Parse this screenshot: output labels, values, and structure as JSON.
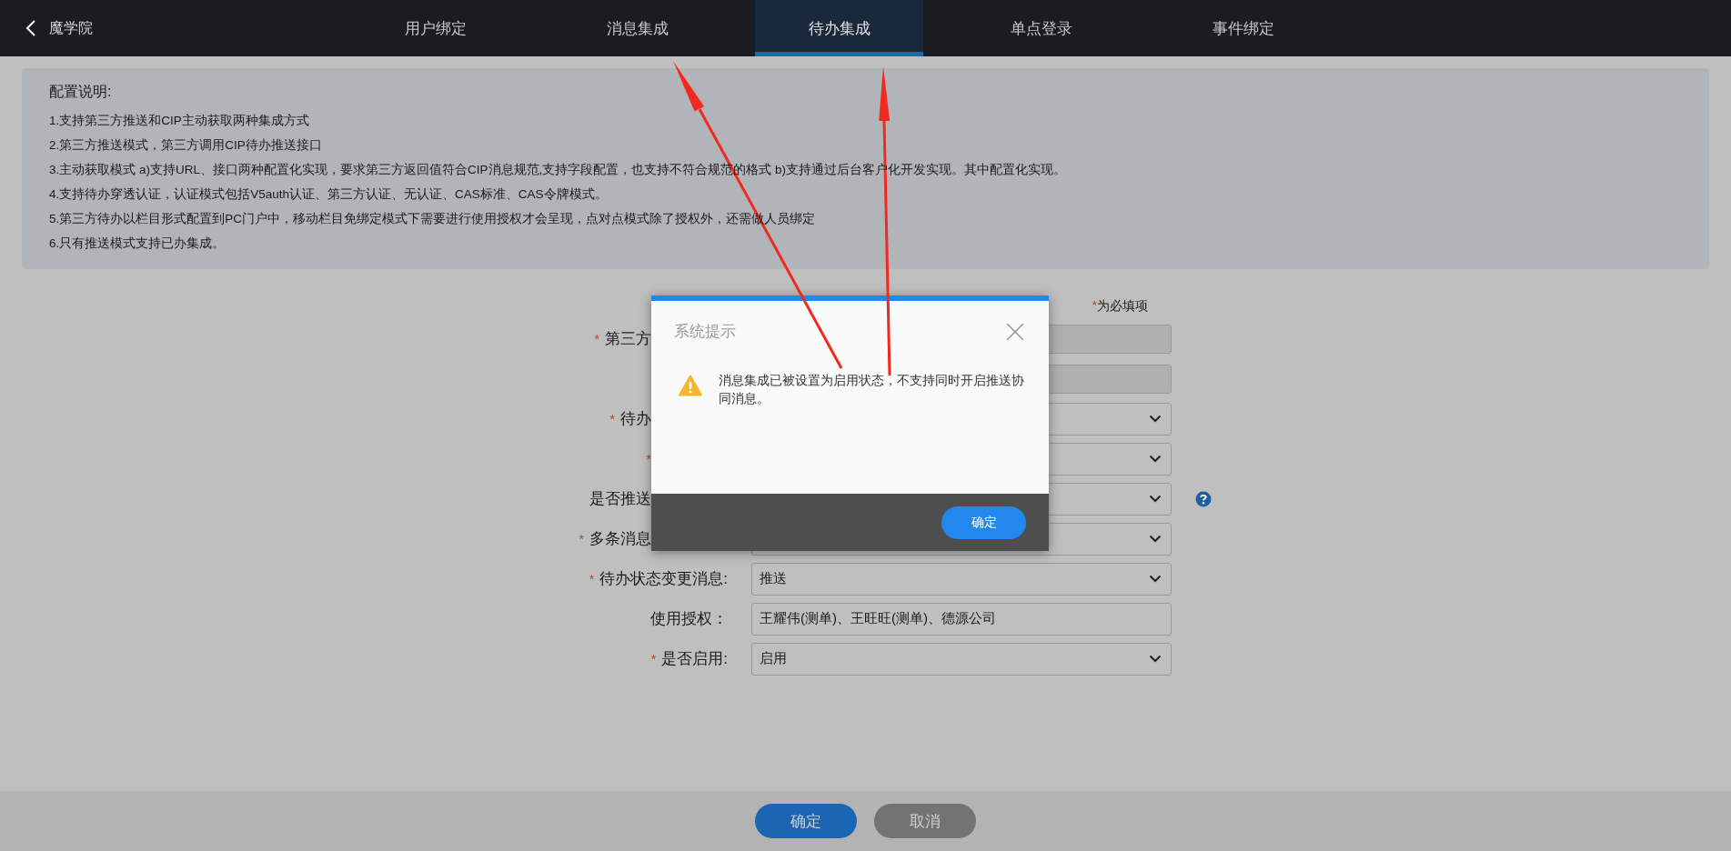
{
  "header": {
    "title": "魔学院",
    "tabs": [
      {
        "label": "用户绑定",
        "selected": false
      },
      {
        "label": "消息集成",
        "selected": false
      },
      {
        "label": "待办集成",
        "selected": true
      },
      {
        "label": "单点登录",
        "selected": false
      },
      {
        "label": "事件绑定",
        "selected": false
      }
    ]
  },
  "info": {
    "title": "配置说明:",
    "lines": [
      "1.支持第三方推送和CIP主动获取两种集成方式",
      "2.第三方推送模式，第三方调用CIP待办推送接口",
      "3.主动获取模式 a)支持URL、接口两种配置化实现，要求第三方返回值符合CIP消息规范,支持字段配置，也支持不符合规范的格式 b)支持通过后台客户化开发实现。其中配置化实现。",
      "4.支持待办穿透认证，认证模式包括V5auth认证、第三方认证、无认证、CAS标准、CAS令牌模式。",
      "5.第三方待办以栏目形式配置到PC门户中，移动栏目免绑定模式下需要进行使用授权才会呈现，点对点模式除了授权外，还需做人员绑定",
      "6.只有推送模式支持已办集成。"
    ]
  },
  "required_note": {
    "mark": "*",
    "text": "为必填项"
  },
  "form": {
    "fields": [
      {
        "label": "第三方",
        "required": true,
        "covered": true,
        "kind": "text",
        "disabled": true
      },
      {
        "required": false,
        "covered": true,
        "kind": "text",
        "disabled": true
      },
      {
        "label": "待办",
        "required": true,
        "covered": true,
        "kind": "select",
        "disabled": false
      },
      {
        "required": true,
        "covered": true,
        "kind": "select",
        "disabled": false
      },
      {
        "label": "是否推送",
        "required": false,
        "covered": true,
        "kind": "select",
        "disabled": false,
        "help": true
      },
      {
        "label": "多条消息",
        "required": true,
        "covered": true,
        "kind": "select",
        "disabled": false
      },
      {
        "label": "待办状态变更消息:",
        "required": true,
        "kind": "select",
        "disabled": false,
        "value": "推送"
      },
      {
        "label": "使用授权：",
        "required": false,
        "kind": "text",
        "disabled": false,
        "value": "王耀伟(测单)、王旺旺(测单)、德源公司"
      },
      {
        "label": "是否启用:",
        "required": true,
        "kind": "select",
        "disabled": false,
        "value": "启用"
      }
    ]
  },
  "footer": {
    "buttons": [
      {
        "label": "确定",
        "kind": "primary"
      },
      {
        "label": "取消",
        "kind": "secondary"
      }
    ]
  },
  "dialog": {
    "title": "系统提示",
    "message": "消息集成已被设置为启用状态，不支持同时开启推送协同消息。",
    "button": "确定"
  }
}
